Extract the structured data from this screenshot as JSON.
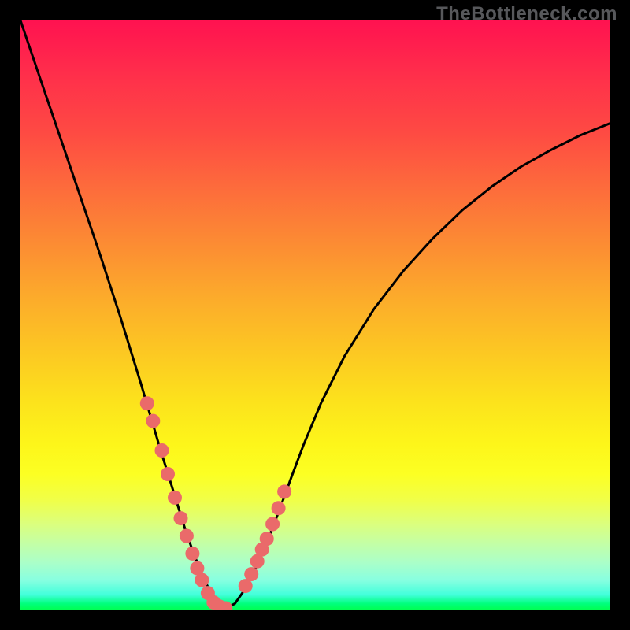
{
  "watermark": "TheBottleneck.com",
  "chart_data": {
    "type": "line",
    "title": "",
    "xlabel": "",
    "ylabel": "",
    "xlim": [
      0,
      1
    ],
    "ylim": [
      0,
      1
    ],
    "x": [
      0.0,
      0.034,
      0.068,
      0.102,
      0.136,
      0.17,
      0.204,
      0.238,
      0.252,
      0.266,
      0.28,
      0.294,
      0.308,
      0.322,
      0.336,
      0.35,
      0.364,
      0.378,
      0.392,
      0.406,
      0.42,
      0.44,
      0.46,
      0.48,
      0.51,
      0.55,
      0.6,
      0.65,
      0.7,
      0.75,
      0.8,
      0.85,
      0.9,
      0.95,
      1.0
    ],
    "y": [
      1.0,
      0.9,
      0.8,
      0.7,
      0.6,
      0.495,
      0.385,
      0.27,
      0.225,
      0.18,
      0.135,
      0.095,
      0.06,
      0.03,
      0.013,
      0.003,
      0.01,
      0.03,
      0.055,
      0.085,
      0.118,
      0.17,
      0.225,
      0.278,
      0.35,
      0.43,
      0.51,
      0.575,
      0.63,
      0.678,
      0.718,
      0.752,
      0.78,
      0.805,
      0.825
    ],
    "highlight_points_x": [
      0.215,
      0.225,
      0.24,
      0.25,
      0.262,
      0.272,
      0.282,
      0.292,
      0.3,
      0.308,
      0.318,
      0.328,
      0.338,
      0.348,
      0.382,
      0.392,
      0.402,
      0.41,
      0.418,
      0.428,
      0.438,
      0.448
    ],
    "highlight_points_y": [
      0.35,
      0.32,
      0.27,
      0.23,
      0.19,
      0.155,
      0.125,
      0.095,
      0.07,
      0.05,
      0.028,
      0.012,
      0.005,
      0.002,
      0.04,
      0.06,
      0.082,
      0.102,
      0.12,
      0.145,
      0.172,
      0.2
    ],
    "colors": {
      "curve": "#000000",
      "highlight": "#EA6A6A"
    }
  }
}
